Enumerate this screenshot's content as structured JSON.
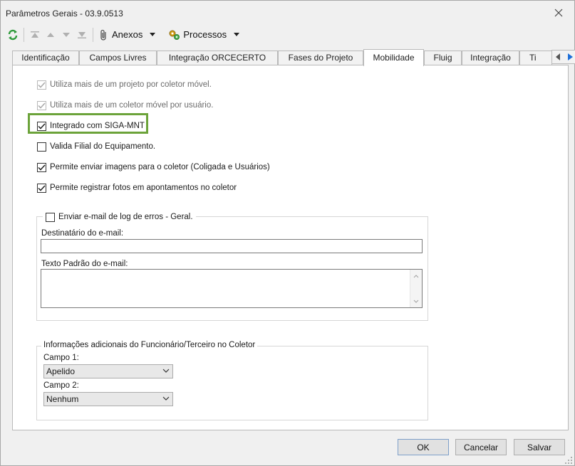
{
  "window": {
    "title": "Parâmetros Gerais - 03.9.0513"
  },
  "toolbar": {
    "anexos_label": "Anexos",
    "processos_label": "Processos"
  },
  "tabs": [
    {
      "label": "Identificação",
      "active": false
    },
    {
      "label": "Campos Livres",
      "active": false
    },
    {
      "label": "Integração ORCECERTO",
      "active": false
    },
    {
      "label": "Fases do Projeto",
      "active": false
    },
    {
      "label": "Mobilidade",
      "active": true
    },
    {
      "label": "Fluig",
      "active": false
    },
    {
      "label": "Integração",
      "active": false
    },
    {
      "label": "Ti",
      "active": false
    }
  ],
  "options": [
    {
      "label": "Utiliza mais de um projeto por coletor móvel.",
      "checked": true,
      "disabled": true
    },
    {
      "label": "Utiliza mais de um coletor móvel por usuário.",
      "checked": true,
      "disabled": true
    },
    {
      "label": "Integrado com SIGA-MNT",
      "checked": true,
      "disabled": false
    },
    {
      "label": "Valida Filial do Equipamento.",
      "checked": false,
      "disabled": false
    },
    {
      "label": "Permite enviar imagens para o coletor (Coligada e Usuários)",
      "checked": true,
      "disabled": false
    },
    {
      "label": "Permite registrar fotos em apontamentos no coletor",
      "checked": true,
      "disabled": false
    }
  ],
  "email_group": {
    "legend": "Enviar e-mail de log de erros - Geral.",
    "checked": false,
    "recipient_label": "Destinatário do e-mail:",
    "recipient_value": "",
    "body_label": "Texto Padrão do e-mail:",
    "body_value": ""
  },
  "extra_group": {
    "legend": "Informações adicionais do Funcionário/Terceiro no Coletor",
    "campo1_label": "Campo 1:",
    "campo1_value": "Apelido",
    "campo2_label": "Campo 2:",
    "campo2_value": "Nenhum"
  },
  "footer": {
    "ok_label": "OK",
    "cancel_label": "Cancelar",
    "save_label": "Salvar"
  },
  "colors": {
    "highlight": "#6ca33a",
    "refresh_icon": "#2e9a3a",
    "processos_icon": "#d4a017"
  }
}
